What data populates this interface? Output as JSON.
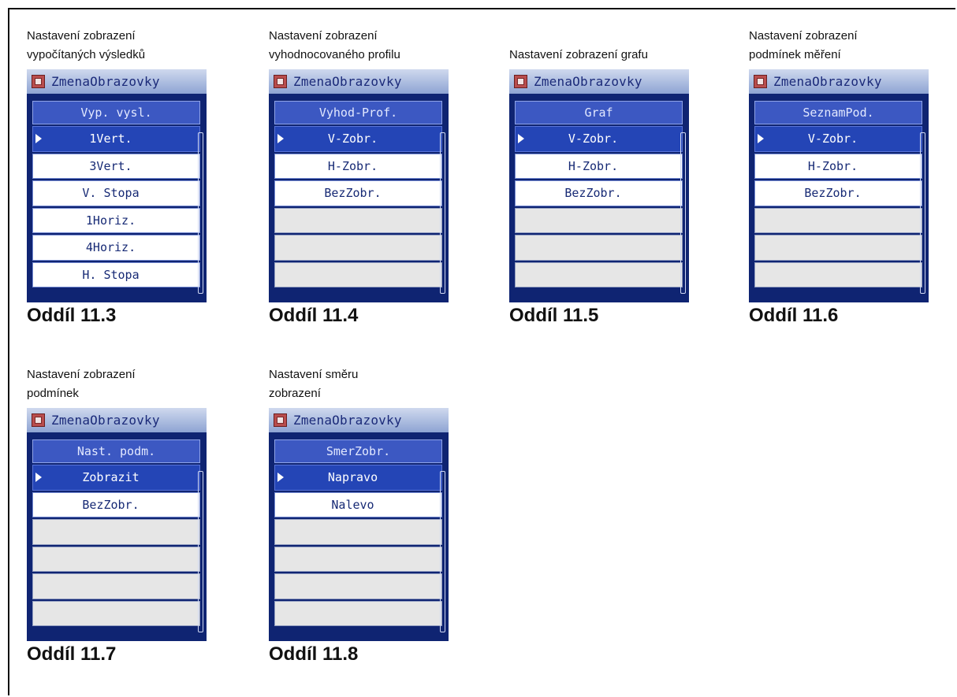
{
  "window_title": "ZmenaObrazovky",
  "panels": [
    {
      "caption": [
        "Nastavení zobrazení",
        "vypočítaných výsledků"
      ],
      "header": "Vyp. vysl.",
      "rows": [
        "1Vert.",
        "3Vert.",
        "V. Stopa",
        "1Horiz.",
        "4Horiz.",
        "H. Stopa"
      ],
      "selected": 0,
      "section": "Oddíl 11.3"
    },
    {
      "caption": [
        "Nastavení zobrazení",
        "vyhodnocovaného profilu"
      ],
      "header": "Vyhod-Prof.",
      "rows": [
        "V-Zobr.",
        "H-Zobr.",
        "BezZobr.",
        "",
        "",
        ""
      ],
      "selected": 0,
      "section": "Oddíl 11.4"
    },
    {
      "caption": [
        "Nastavení zobrazení grafu"
      ],
      "header": "Graf",
      "rows": [
        "V-Zobr.",
        "H-Zobr.",
        "BezZobr.",
        "",
        "",
        ""
      ],
      "selected": 0,
      "section": "Oddíl 11.5"
    },
    {
      "caption": [
        "Nastavení zobrazení",
        "podmínek měření"
      ],
      "header": "SeznamPod.",
      "rows": [
        "V-Zobr.",
        "H-Zobr.",
        "BezZobr.",
        "",
        "",
        ""
      ],
      "selected": 0,
      "section": "Oddíl 11.6"
    },
    {
      "caption": [
        "Nastavení zobrazení",
        "podmínek"
      ],
      "header": "Nast. podm.",
      "rows": [
        "Zobrazit",
        "BezZobr.",
        "",
        "",
        "",
        ""
      ],
      "selected": 0,
      "section": "Oddíl 11.7"
    },
    {
      "caption": [
        "Nastavení směru",
        "zobrazení"
      ],
      "header": "SmerZobr.",
      "rows": [
        "Napravo",
        "Nalevo",
        "",
        "",
        "",
        ""
      ],
      "selected": 0,
      "section": "Oddíl 11.8"
    }
  ]
}
